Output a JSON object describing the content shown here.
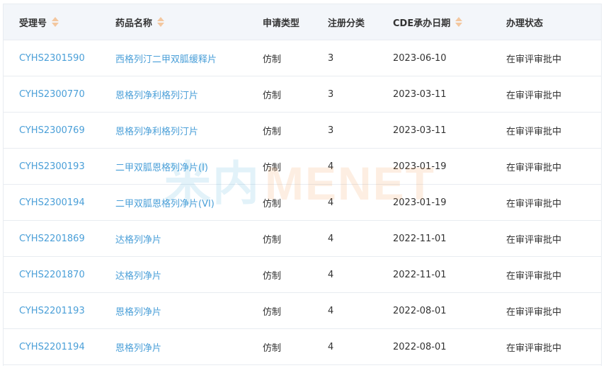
{
  "table": {
    "headers": {
      "accept_no": "受理号",
      "drug_name": "药品名称",
      "apply_type": "申请类型",
      "reg_class": "注册分类",
      "cde_date": "CDE承办日期",
      "status": "办理状态"
    },
    "rows": [
      {
        "accept_no": "CYHS2301590",
        "drug_name": "西格列汀二甲双胍缓释片",
        "apply_type": "仿制",
        "reg_class": "3",
        "cde_date": "2023-06-10",
        "status": "在审评审批中"
      },
      {
        "accept_no": "CYHS2300770",
        "drug_name": "恩格列净利格列汀片",
        "apply_type": "仿制",
        "reg_class": "3",
        "cde_date": "2023-03-11",
        "status": "在审评审批中"
      },
      {
        "accept_no": "CYHS2300769",
        "drug_name": "恩格列净利格列汀片",
        "apply_type": "仿制",
        "reg_class": "3",
        "cde_date": "2023-03-11",
        "status": "在审评审批中"
      },
      {
        "accept_no": "CYHS2300193",
        "drug_name": "二甲双胍恩格列净片(Ⅰ)",
        "apply_type": "仿制",
        "reg_class": "4",
        "cde_date": "2023-01-19",
        "status": "在审评审批中"
      },
      {
        "accept_no": "CYHS2300194",
        "drug_name": "二甲双胍恩格列净片(VI)",
        "apply_type": "仿制",
        "reg_class": "4",
        "cde_date": "2023-01-19",
        "status": "在审评审批中"
      },
      {
        "accept_no": "CYHS2201869",
        "drug_name": "达格列净片",
        "apply_type": "仿制",
        "reg_class": "4",
        "cde_date": "2022-11-01",
        "status": "在审评审批中"
      },
      {
        "accept_no": "CYHS2201870",
        "drug_name": "达格列净片",
        "apply_type": "仿制",
        "reg_class": "4",
        "cde_date": "2022-11-01",
        "status": "在审评审批中"
      },
      {
        "accept_no": "CYHS2201193",
        "drug_name": "恩格列净片",
        "apply_type": "仿制",
        "reg_class": "4",
        "cde_date": "2022-08-01",
        "status": "在审评审批中"
      },
      {
        "accept_no": "CYHS2201194",
        "drug_name": "恩格列净片",
        "apply_type": "仿制",
        "reg_class": "4",
        "cde_date": "2022-08-01",
        "status": "在审评审批中"
      }
    ]
  },
  "watermark": {
    "cn": "米内",
    "en": "MENET"
  },
  "colors": {
    "link": "#4a9fd8",
    "sort_arrow": "#f3c79f",
    "header_bg": "#f3f6fa",
    "border": "#e8ecf1"
  }
}
